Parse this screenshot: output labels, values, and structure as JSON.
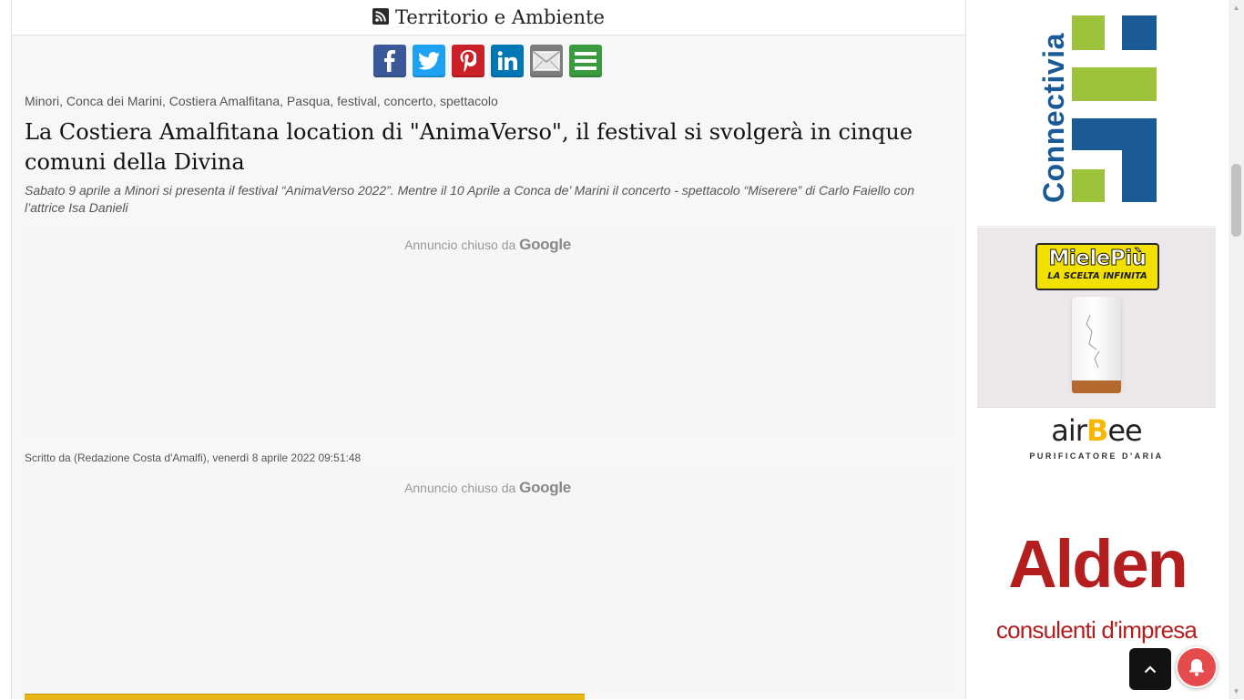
{
  "section": {
    "title": "Territorio e Ambiente",
    "icon": "rss-icon"
  },
  "share": {
    "buttons": [
      {
        "name": "facebook",
        "icon": "facebook-icon",
        "color": "#3b5998"
      },
      {
        "name": "twitter",
        "icon": "twitter-icon",
        "color": "#1da1f2"
      },
      {
        "name": "pinterest",
        "icon": "pinterest-icon",
        "color": "#cb2027"
      },
      {
        "name": "linkedin",
        "icon": "linkedin-icon",
        "color": "#0077b5"
      },
      {
        "name": "email",
        "icon": "email-icon",
        "color": "#7d7d7d"
      },
      {
        "name": "more",
        "icon": "share-more-icon",
        "color": "#3a9a3e"
      }
    ]
  },
  "article": {
    "tags": "Minori, Conca dei Marini, Costiera Amalfitana, Pasqua, festival, concerto, spettacolo",
    "headline": "La Costiera Amalfitana location di \"AnimaVerso\", il festival si svolgerà in cinque comuni della Divina",
    "subtitle": "Sabato 9 aprile a Minori si presenta il festival “AnimaVerso 2022”. Mentre il 10 Aprile a Conca de’ Marini il concerto - spettacolo “Miserere” di Carlo Faiello con l’attrice Isa Danieli",
    "byline": "Scritto da (Redazione Costa d'Amalfi), venerdì 8 aprile 2022 09:51:48"
  },
  "ads": {
    "closed_prefix": "Annuncio chiuso da",
    "closed_brand": "Google"
  },
  "sidebar": {
    "connectivia": {
      "text": "Connectivia",
      "green": "#9dc23b",
      "blue": "#1a5a96"
    },
    "miele": {
      "logo": "MielePiù",
      "tagline": "LA SCELTA INFINITA",
      "brand": "airBee",
      "brand_a": "air",
      "brand_b": "B",
      "brand_c": "ee",
      "brand_sub": "PURIFICATORE D'ARIA"
    },
    "alden": {
      "name": "Alden",
      "sub": "consulenti d'impresa",
      "color": "#b41e1e"
    }
  },
  "controls": {
    "back_to_top_icon": "chevron-up-icon",
    "notification_icon": "bell-icon"
  }
}
